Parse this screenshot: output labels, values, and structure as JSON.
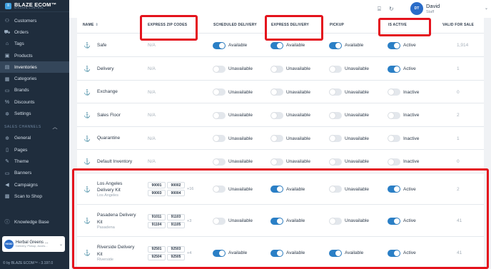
{
  "brand": {
    "name": "BLAZE ECOM",
    "tagline": "MISSION CONTROL",
    "tm": "™"
  },
  "sidebar": {
    "items": [
      {
        "label": "Customers",
        "icon": "people-icon",
        "glyph": "⚇"
      },
      {
        "label": "Orders",
        "icon": "cart-icon",
        "glyph": "⛟"
      },
      {
        "label": "Tags",
        "icon": "tag-icon",
        "glyph": "⌂"
      },
      {
        "label": "Products",
        "icon": "box-icon",
        "glyph": "▣"
      },
      {
        "label": "Inventories",
        "icon": "clipboard-icon",
        "glyph": "▤"
      },
      {
        "label": "Categories",
        "icon": "grid-icon",
        "glyph": "▦"
      },
      {
        "label": "Brands",
        "icon": "briefcase-icon",
        "glyph": "▭"
      },
      {
        "label": "Discounts",
        "icon": "discount-icon",
        "glyph": "%"
      },
      {
        "label": "Settings",
        "icon": "gear-icon",
        "glyph": "✲"
      }
    ],
    "section_label": "SALES CHANNELS",
    "channel_items": [
      {
        "label": "General",
        "icon": "gear-icon",
        "glyph": "✲"
      },
      {
        "label": "Pages",
        "icon": "page-icon",
        "glyph": "▯"
      },
      {
        "label": "Theme",
        "icon": "brush-icon",
        "glyph": "✎"
      },
      {
        "label": "Banners",
        "icon": "banner-icon",
        "glyph": "▭"
      },
      {
        "label": "Campaigns",
        "icon": "megaphone-icon",
        "glyph": "◀"
      },
      {
        "label": "Scan to Shop",
        "icon": "qr-icon",
        "glyph": "▩"
      }
    ],
    "knowledge_base": "Knowledge Base",
    "store": {
      "avatar": "HGDD",
      "name": "Herbal Greens ...",
      "type": "Delivery, Pickup, Acces..."
    },
    "footer": "by BLAZE ECOM™ - 3.197.0"
  },
  "topbar": {
    "user_initials": "DT",
    "user_name": "David",
    "user_role": "Staff"
  },
  "table": {
    "headers": {
      "name": "NAME",
      "zip": "EXPRESS ZIP CODES",
      "scheduled": "SCHEDULED DELIVERY",
      "express": "EXPRESS DELIVERY",
      "pickup": "PICKUP",
      "active": "IS ACTIVE",
      "valid": "VALID FOR SALE"
    },
    "rows": [
      {
        "name": "Safe",
        "sub": "",
        "zip": "N/A",
        "zips": [],
        "more": "",
        "scheduled": {
          "on": true,
          "label": "Available"
        },
        "express": {
          "on": true,
          "label": "Available"
        },
        "pickup": {
          "on": true,
          "label": "Available"
        },
        "active": {
          "on": true,
          "label": "Active"
        },
        "valid": "1,914"
      },
      {
        "name": "Delivery",
        "sub": "",
        "zip": "N/A",
        "zips": [],
        "more": "",
        "scheduled": {
          "on": false,
          "label": "Unavailable"
        },
        "express": {
          "on": false,
          "label": "Unavailable"
        },
        "pickup": {
          "on": false,
          "label": "Unavailable"
        },
        "active": {
          "on": true,
          "label": "Active"
        },
        "valid": "1"
      },
      {
        "name": "Exchange",
        "sub": "",
        "zip": "N/A",
        "zips": [],
        "more": "",
        "scheduled": {
          "on": false,
          "label": "Unavailable"
        },
        "express": {
          "on": false,
          "label": "Unavailable"
        },
        "pickup": {
          "on": false,
          "label": "Unavailable"
        },
        "active": {
          "on": false,
          "label": "Inactive"
        },
        "valid": "0"
      },
      {
        "name": "Sales Floor",
        "sub": "",
        "zip": "N/A",
        "zips": [],
        "more": "",
        "scheduled": {
          "on": false,
          "label": "Unavailable"
        },
        "express": {
          "on": false,
          "label": "Unavailable"
        },
        "pickup": {
          "on": false,
          "label": "Unavailable"
        },
        "active": {
          "on": false,
          "label": "Inactive"
        },
        "valid": "2"
      },
      {
        "name": "Quarantine",
        "sub": "",
        "zip": "N/A",
        "zips": [],
        "more": "",
        "scheduled": {
          "on": false,
          "label": "Unavailable"
        },
        "express": {
          "on": false,
          "label": "Unavailable"
        },
        "pickup": {
          "on": false,
          "label": "Unavailable"
        },
        "active": {
          "on": false,
          "label": "Inactive"
        },
        "valid": "1"
      },
      {
        "name": "Default Inventory",
        "sub": "",
        "zip": "N/A",
        "zips": [],
        "more": "",
        "scheduled": {
          "on": false,
          "label": "Unavailable"
        },
        "express": {
          "on": false,
          "label": "Unavailable"
        },
        "pickup": {
          "on": false,
          "label": "Unavailable"
        },
        "active": {
          "on": false,
          "label": "Inactive"
        },
        "valid": "0"
      },
      {
        "name": "Los Angeles Delivery Kit",
        "sub": "Los Angeles",
        "zip": "",
        "zips": [
          "90001",
          "90002",
          "90003",
          "90004"
        ],
        "more": "+16",
        "scheduled": {
          "on": false,
          "label": "Unavailable"
        },
        "express": {
          "on": true,
          "label": "Available"
        },
        "pickup": {
          "on": false,
          "label": "Unavailable"
        },
        "active": {
          "on": true,
          "label": "Active"
        },
        "valid": "2"
      },
      {
        "name": "Pasadena Delivery Kit",
        "sub": "Pasadena",
        "zip": "",
        "zips": [
          "91011",
          "91103",
          "91104",
          "91105"
        ],
        "more": "+3",
        "scheduled": {
          "on": false,
          "label": "Unavailable"
        },
        "express": {
          "on": true,
          "label": "Available"
        },
        "pickup": {
          "on": false,
          "label": "Unavailable"
        },
        "active": {
          "on": true,
          "label": "Active"
        },
        "valid": "41"
      },
      {
        "name": "Riverside Delivery Kit",
        "sub": "Riverside",
        "zip": "",
        "zips": [
          "92501",
          "92503",
          "92504",
          "92505"
        ],
        "more": "+4",
        "scheduled": {
          "on": true,
          "label": "Available"
        },
        "express": {
          "on": true,
          "label": "Available"
        },
        "pickup": {
          "on": true,
          "label": "Available"
        },
        "active": {
          "on": true,
          "label": "Active"
        },
        "valid": "41"
      }
    ]
  },
  "colors": {
    "sidebar": "#1f2d3d",
    "accent": "#2a7fc6",
    "highlight": "#e4131d"
  }
}
